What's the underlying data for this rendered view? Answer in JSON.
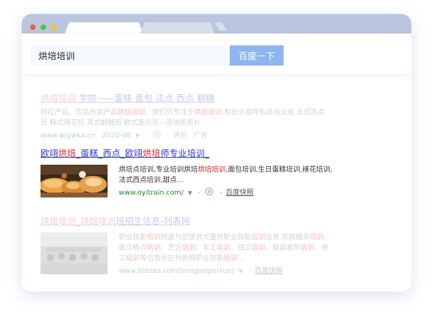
{
  "search": {
    "query": "烘培培训",
    "button_label": "百度一下"
  },
  "results": [
    {
      "title_parts": [
        "烘焙培训",
        " 学院——",
        "蛋糕 面包 法点 西点 翻糖"
      ],
      "desc_line1_parts": [
        "网红产品，饮品热卖产品",
        "烘焙培训",
        "，我们只专注于",
        "烘焙培训",
        " 和创业指导私房创业班 法式西点"
      ],
      "desc_line2": "班 韩式裱花班 英式翻糖班 欧式面包班—咨询即有礼",
      "url": "www.wlywka.cn",
      "date": "2020-08",
      "extra": "评价",
      "ad": "广告"
    },
    {
      "title_parts": [
        "欧翊",
        "烘焙",
        "_蛋糕_西点_欧翊",
        "烘培",
        "师专业培训_"
      ],
      "desc_line1_parts": [
        "烘培点培训,专业培训烘培",
        "烘培培训",
        ",面包培训,生日蛋糕培训,裱花培训,"
      ],
      "desc_line2": "法式西点培训,甜点...",
      "url": "www.oyitrain.com/",
      "cache": "百度快照"
    },
    {
      "title_parts": [
        "烘焙培训",
        "_烘焙培训",
        "班招生信息-列表网"
      ],
      "desc_line1_parts": [
        "职业技能",
        "培训",
        "频道为您提供大量的职业技能",
        "培训",
        "信息,家政服务",
        "培训",
        ","
      ],
      "desc_line2_parts": [
        "面点糕点",
        "培训",
        "、烹饪",
        "培训",
        "、车工",
        "培训",
        "、钳工",
        "培训",
        "、服装裁剪",
        "培训",
        "、电"
      ],
      "desc_line3_parts": [
        "工",
        "培训",
        "等信息尽在列表网职业技能",
        "培训",
        "..."
      ],
      "url": "www.liebiao.com/hongpeipeixun/",
      "cache": "百度快照"
    }
  ]
}
